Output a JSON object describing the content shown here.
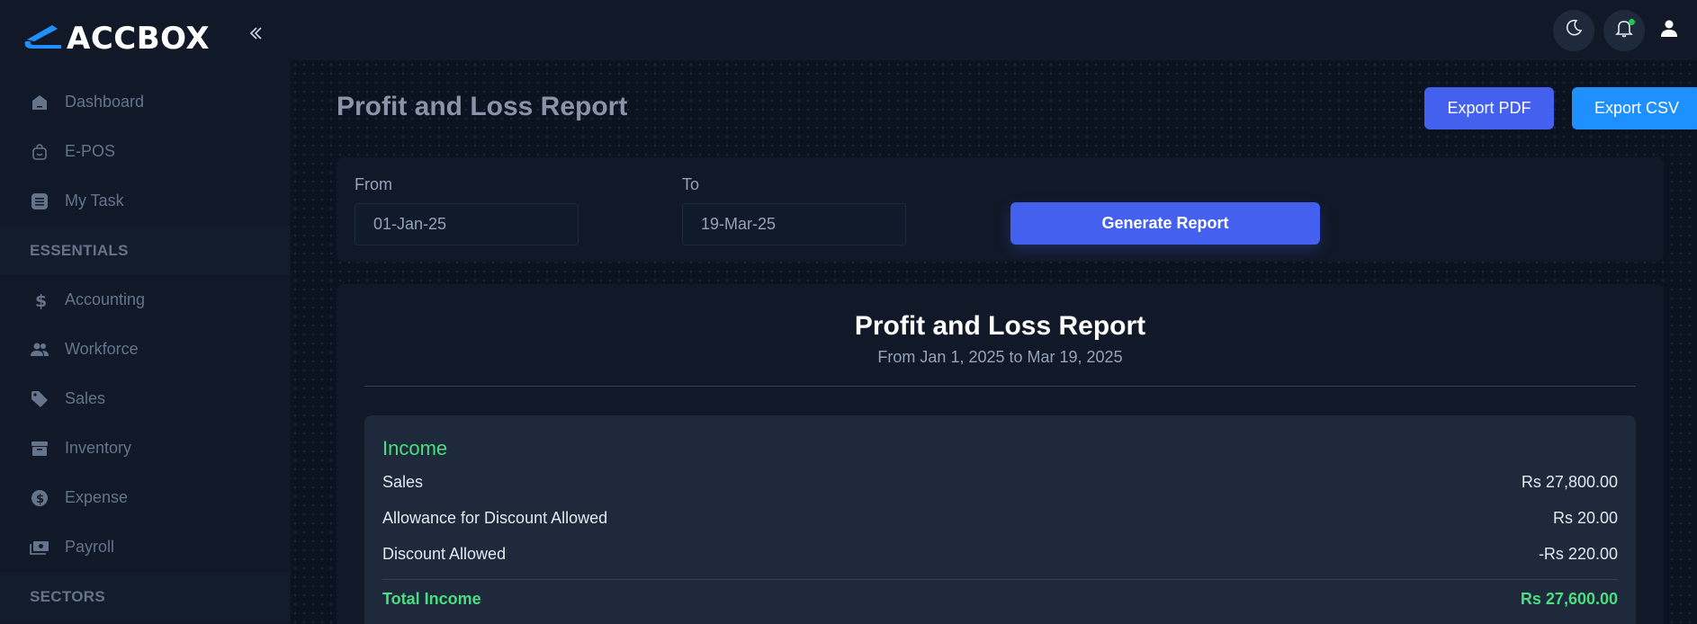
{
  "brand": {
    "name": "ACCBOX"
  },
  "sidebar": {
    "items": [
      {
        "label": "Dashboard",
        "icon": "home-icon"
      },
      {
        "label": "E-POS",
        "icon": "shopping-bag-icon"
      },
      {
        "label": "My Task",
        "icon": "list-icon"
      }
    ],
    "sections": [
      {
        "title": "ESSENTIALS",
        "items": [
          {
            "label": "Accounting",
            "icon": "dollar-icon"
          },
          {
            "label": "Workforce",
            "icon": "people-icon"
          },
          {
            "label": "Sales",
            "icon": "tag-icon"
          },
          {
            "label": "Inventory",
            "icon": "archive-icon"
          },
          {
            "label": "Expense",
            "icon": "coin-icon"
          },
          {
            "label": "Payroll",
            "icon": "cash-icon"
          }
        ]
      },
      {
        "title": "SECTORS",
        "items": []
      }
    ]
  },
  "topbar": {
    "notification_dot_color": "#22c55e"
  },
  "page": {
    "title": "Profit and Loss Report",
    "export_pdf": "Export PDF",
    "export_csv": "Export CSV"
  },
  "filter": {
    "from_label": "From",
    "from_value": "01-Jan-25",
    "to_label": "To",
    "to_value": "19-Mar-25",
    "generate_label": "Generate Report"
  },
  "report": {
    "title": "Profit and Loss Report",
    "range": "From Jan 1, 2025 to Mar 19, 2025",
    "income": {
      "title": "Income",
      "rows": [
        {
          "label": "Sales",
          "amount": "Rs 27,800.00"
        },
        {
          "label": "Allowance for Discount Allowed",
          "amount": "Rs 20.00"
        },
        {
          "label": "Discount Allowed",
          "amount": "-Rs 220.00"
        }
      ],
      "total_label": "Total Income",
      "total_amount": "Rs 27,600.00"
    }
  },
  "colors": {
    "accent": "#4361ee",
    "csv_button": "#1e90ff",
    "income_green": "#4ade80"
  }
}
